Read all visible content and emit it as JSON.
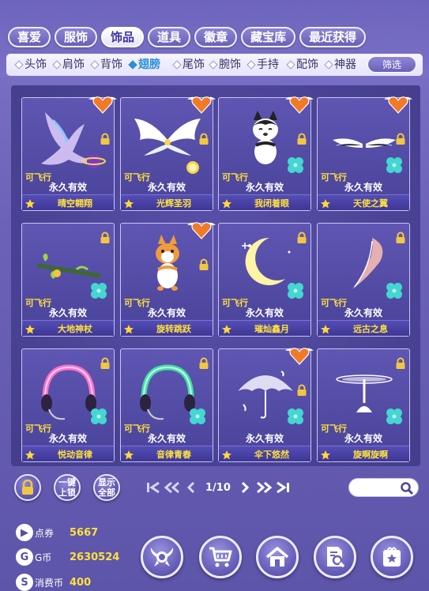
{
  "tabs": [
    {
      "label": "喜爱",
      "active": false
    },
    {
      "label": "服饰",
      "active": false
    },
    {
      "label": "饰品",
      "active": true
    },
    {
      "label": "道具",
      "active": false
    },
    {
      "label": "徽章",
      "active": false
    },
    {
      "label": "藏宝库",
      "active": false
    },
    {
      "label": "最近获得",
      "active": false
    }
  ],
  "subcategories": [
    {
      "label": "头饰",
      "active": false
    },
    {
      "label": "肩饰",
      "active": false
    },
    {
      "label": "背饰",
      "active": false
    },
    {
      "label": "翅膀",
      "active": true
    },
    {
      "label": "尾饰",
      "active": false
    },
    {
      "label": "腕饰",
      "active": false
    },
    {
      "label": "手持",
      "active": false
    },
    {
      "label": "配饰",
      "active": false
    },
    {
      "label": "神器",
      "active": false
    }
  ],
  "filter_label": "筛选",
  "items": [
    {
      "name": "晴空翱翔",
      "flag": "可飞行",
      "validity": "永久有效",
      "favorite": true,
      "lock": true,
      "clover": false,
      "art": "phoenix"
    },
    {
      "name": "光辉圣羽",
      "flag": "可飞行",
      "validity": "永久有效",
      "favorite": true,
      "lock": true,
      "clover": false,
      "art": "wings-white"
    },
    {
      "name": "我闭着眼",
      "flag": "可飞行",
      "validity": "永久有效",
      "favorite": true,
      "lock": true,
      "clover": true,
      "art": "husky"
    },
    {
      "name": "天使之翼",
      "flag": "可飞行",
      "validity": "永久有效",
      "favorite": true,
      "lock": true,
      "clover": true,
      "art": "wings-small"
    },
    {
      "name": "大地神杖",
      "flag": "可飞行",
      "validity": "永久有效",
      "favorite": false,
      "lock": true,
      "clover": true,
      "art": "staff"
    },
    {
      "name": "旋转跳跃",
      "flag": "可飞行",
      "validity": "永久有效",
      "favorite": true,
      "lock": true,
      "clover": false,
      "art": "corgi"
    },
    {
      "name": "璀灿鑫月",
      "flag": "可飞行",
      "validity": "永久有效",
      "favorite": false,
      "lock": true,
      "clover": true,
      "art": "moon"
    },
    {
      "name": "远古之息",
      "flag": "可飞行",
      "validity": "永久有效",
      "favorite": false,
      "lock": true,
      "clover": true,
      "art": "feather"
    },
    {
      "name": "悦动音律",
      "flag": "可飞行",
      "validity": "永久有效",
      "favorite": false,
      "lock": true,
      "clover": true,
      "art": "headphones-pink"
    },
    {
      "name": "音律青春",
      "flag": "可飞行",
      "validity": "永久有效",
      "favorite": false,
      "lock": true,
      "clover": true,
      "art": "headphones-green"
    },
    {
      "name": "伞下悠然",
      "flag": "",
      "validity": "永久有效",
      "favorite": true,
      "lock": true,
      "clover": true,
      "art": "umbrella"
    },
    {
      "name": "旋啊旋啊",
      "flag": "可飞行",
      "validity": "永久有效",
      "favorite": false,
      "lock": true,
      "clover": true,
      "art": "propeller"
    }
  ],
  "controls": {
    "onekey_lock": "一键\n上锁",
    "show_all": "显示\n全部",
    "page": "1/10",
    "search_placeholder": ""
  },
  "currency": [
    {
      "icon": "ticket-icon",
      "label": "点券",
      "value": "5667"
    },
    {
      "icon": "g-coin-icon",
      "label": "G币",
      "value": "2630524"
    },
    {
      "icon": "s-coin-icon",
      "label": "消费币",
      "value": "400"
    }
  ],
  "nav_icons": [
    "wings-emblem-icon",
    "cart-icon",
    "home-icon",
    "search-doc-icon",
    "gift-icon"
  ],
  "colors": {
    "accent_yellow": "#ffe23a",
    "active_tab_text": "#3d36a3",
    "active_sub": "#2a8fd8"
  }
}
